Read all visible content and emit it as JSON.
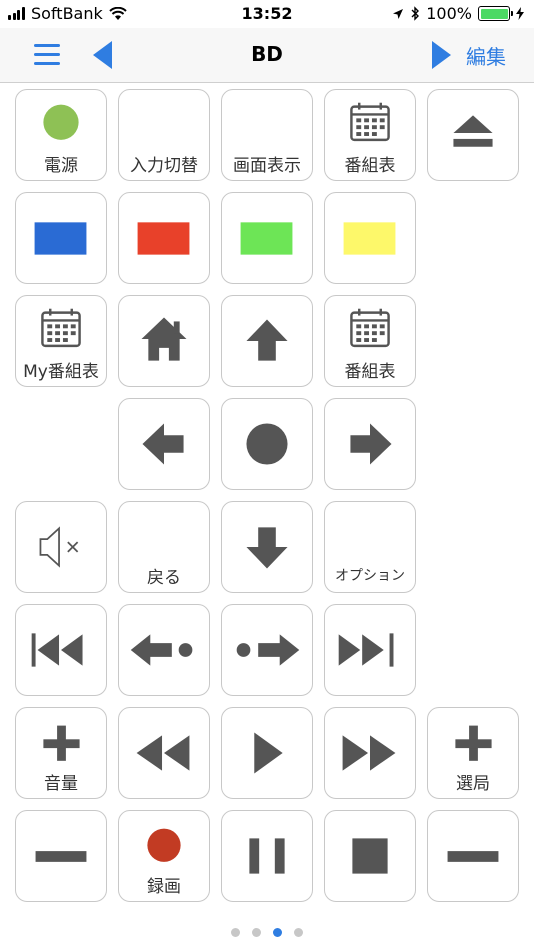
{
  "status": {
    "carrier": "SoftBank",
    "time": "13:52",
    "battery": "100%",
    "battery_level": 1.0
  },
  "nav": {
    "title": "BD",
    "edit_label": "編集"
  },
  "colors": {
    "accent": "#2f7de1",
    "icon": "#555555",
    "power": "#8ec155",
    "blue": "#2a6bd4",
    "red": "#e8412a",
    "green": "#6de556",
    "yellow": "#fdf86a",
    "record": "#c23b23"
  },
  "buttons": {
    "power": "電源",
    "input": "入力切替",
    "display": "画面表示",
    "guide": "番組表",
    "my_guide": "My番組表",
    "guide2": "番組表",
    "back": "戻る",
    "option": "オプション",
    "volume": "音量",
    "channel": "選局",
    "record": "録画"
  },
  "page_indicator": {
    "count": 4,
    "active_index": 2
  }
}
